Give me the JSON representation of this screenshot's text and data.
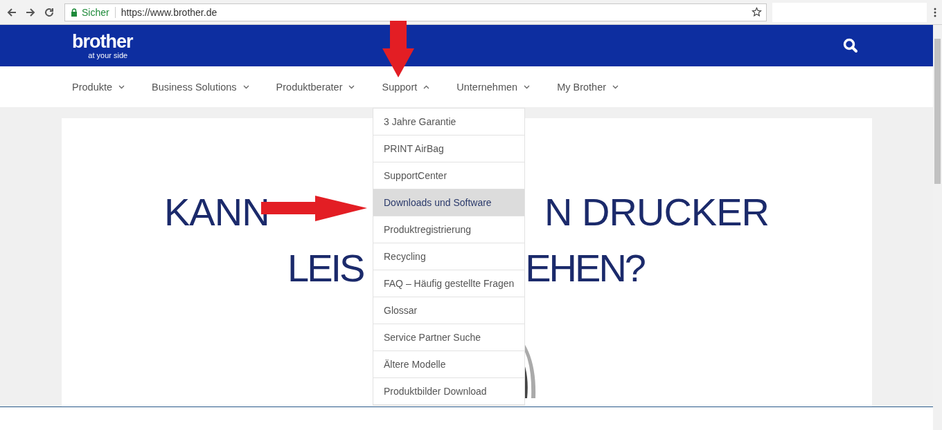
{
  "browser": {
    "security_label": "Sicher",
    "url": "https://www.brother.de"
  },
  "header": {
    "logo_name": "brother",
    "logo_tagline": "at your side"
  },
  "nav": [
    {
      "label": "Produkte",
      "expanded": false
    },
    {
      "label": "Business Solutions",
      "expanded": false
    },
    {
      "label": "Produktberater",
      "expanded": false
    },
    {
      "label": "Support",
      "expanded": true
    },
    {
      "label": "Unternehmen",
      "expanded": false
    },
    {
      "label": "My Brother",
      "expanded": false
    }
  ],
  "dropdown": [
    {
      "label": "3 Jahre Garantie",
      "selected": false
    },
    {
      "label": "PRINT AirBag",
      "selected": false
    },
    {
      "label": "SupportCenter",
      "selected": false
    },
    {
      "label": "Downloads und Software",
      "selected": true
    },
    {
      "label": "Produktregistrierung",
      "selected": false
    },
    {
      "label": "Recycling",
      "selected": false
    },
    {
      "label": "FAQ – Häufig gestellte Fragen",
      "selected": false
    },
    {
      "label": "Glossar",
      "selected": false
    },
    {
      "label": "Service Partner Suche",
      "selected": false
    },
    {
      "label": "Ältere Modelle",
      "selected": false
    },
    {
      "label": "Produktbilder Download",
      "selected": false
    }
  ],
  "headline": [
    [
      "KANN",
      "N DRUCKER"
    ],
    [
      "LEIS",
      "EHEN?"
    ]
  ]
}
